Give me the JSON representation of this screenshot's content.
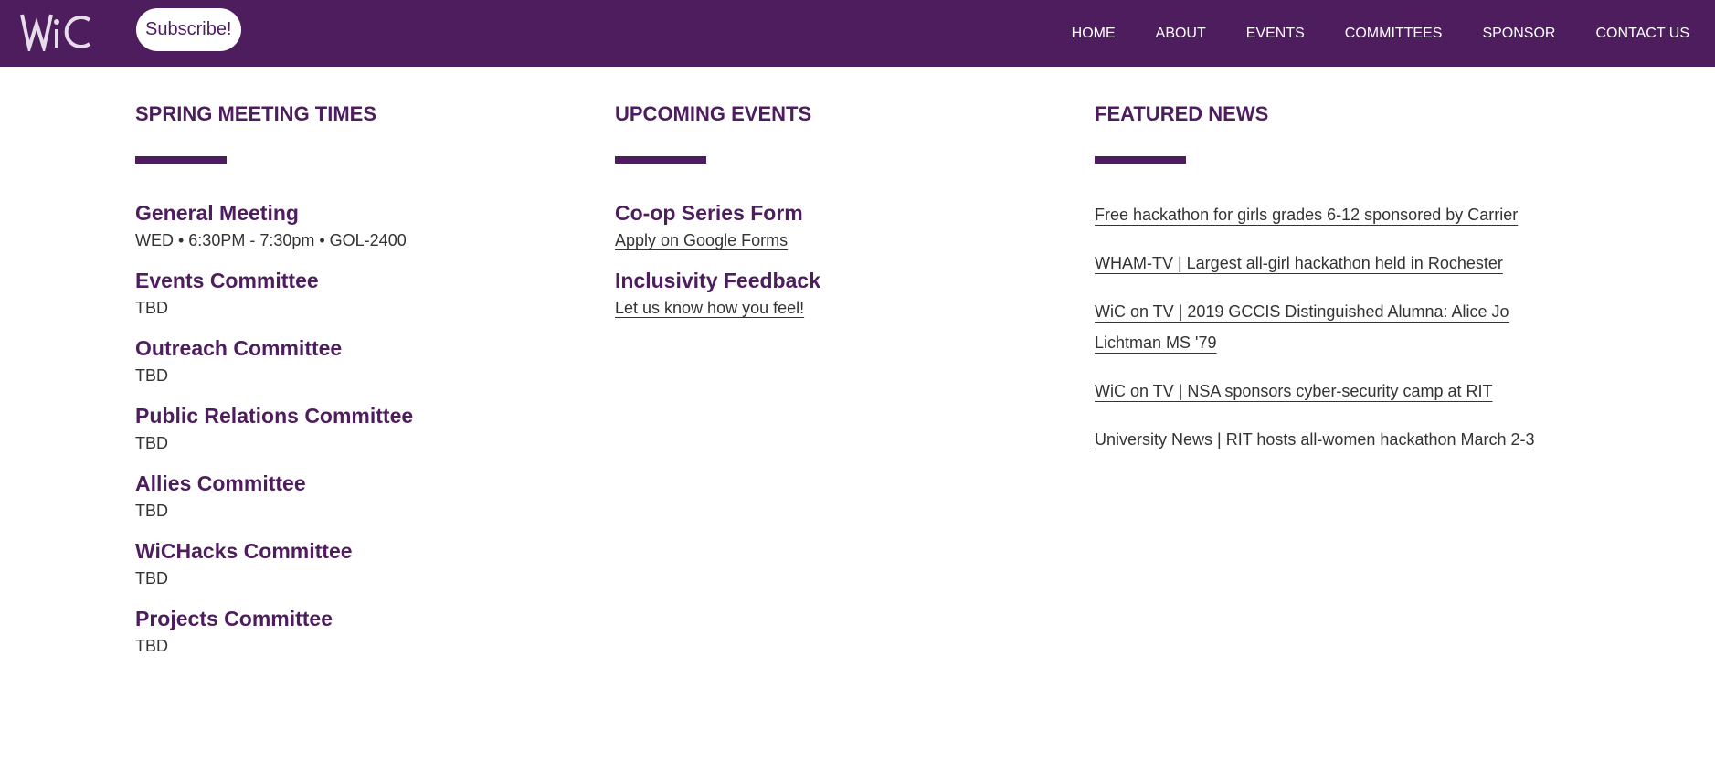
{
  "header": {
    "logo_text": "WiC",
    "subscribe_label": "Subscribe!",
    "nav": [
      "HOME",
      "ABOUT",
      "EVENTS",
      "COMMITTEES",
      "SPONSOR",
      "CONTACT US"
    ]
  },
  "colors": {
    "brand_purple": "#4e1d5e",
    "text_gray": "#333333"
  },
  "meeting_times": {
    "title": "SPRING MEETING TIMES",
    "items": [
      {
        "name": "General Meeting",
        "detail": "WED • 6:30PM - 7:30pm • GOL-2400"
      },
      {
        "name": "Events Committee",
        "detail": "TBD"
      },
      {
        "name": "Outreach Committee",
        "detail": "TBD"
      },
      {
        "name": "Public Relations Committee",
        "detail": "TBD"
      },
      {
        "name": "Allies Committee",
        "detail": "TBD"
      },
      {
        "name": "WiCHacks Committee",
        "detail": "TBD"
      },
      {
        "name": "Projects Committee",
        "detail": "TBD"
      }
    ]
  },
  "upcoming_events": {
    "title": "UPCOMING EVENTS",
    "items": [
      {
        "name": "Co-op Series Form",
        "link": "Apply on Google Forms"
      },
      {
        "name": "Inclusivity Feedback",
        "link": "Let us know how you feel!"
      }
    ]
  },
  "featured_news": {
    "title": "FEATURED NEWS",
    "items": [
      "Free hackathon for girls grades 6-12 sponsored by Carrier",
      "WHAM-TV | Largest all-girl hackathon held in Rochester",
      "WiC on TV | 2019 GCCIS Distinguished Alumna: Alice Jo Lichtman MS '79",
      "WiC on TV | NSA sponsors cyber-security camp at RIT",
      "University News | RIT hosts all-women hackathon March 2-3"
    ]
  }
}
